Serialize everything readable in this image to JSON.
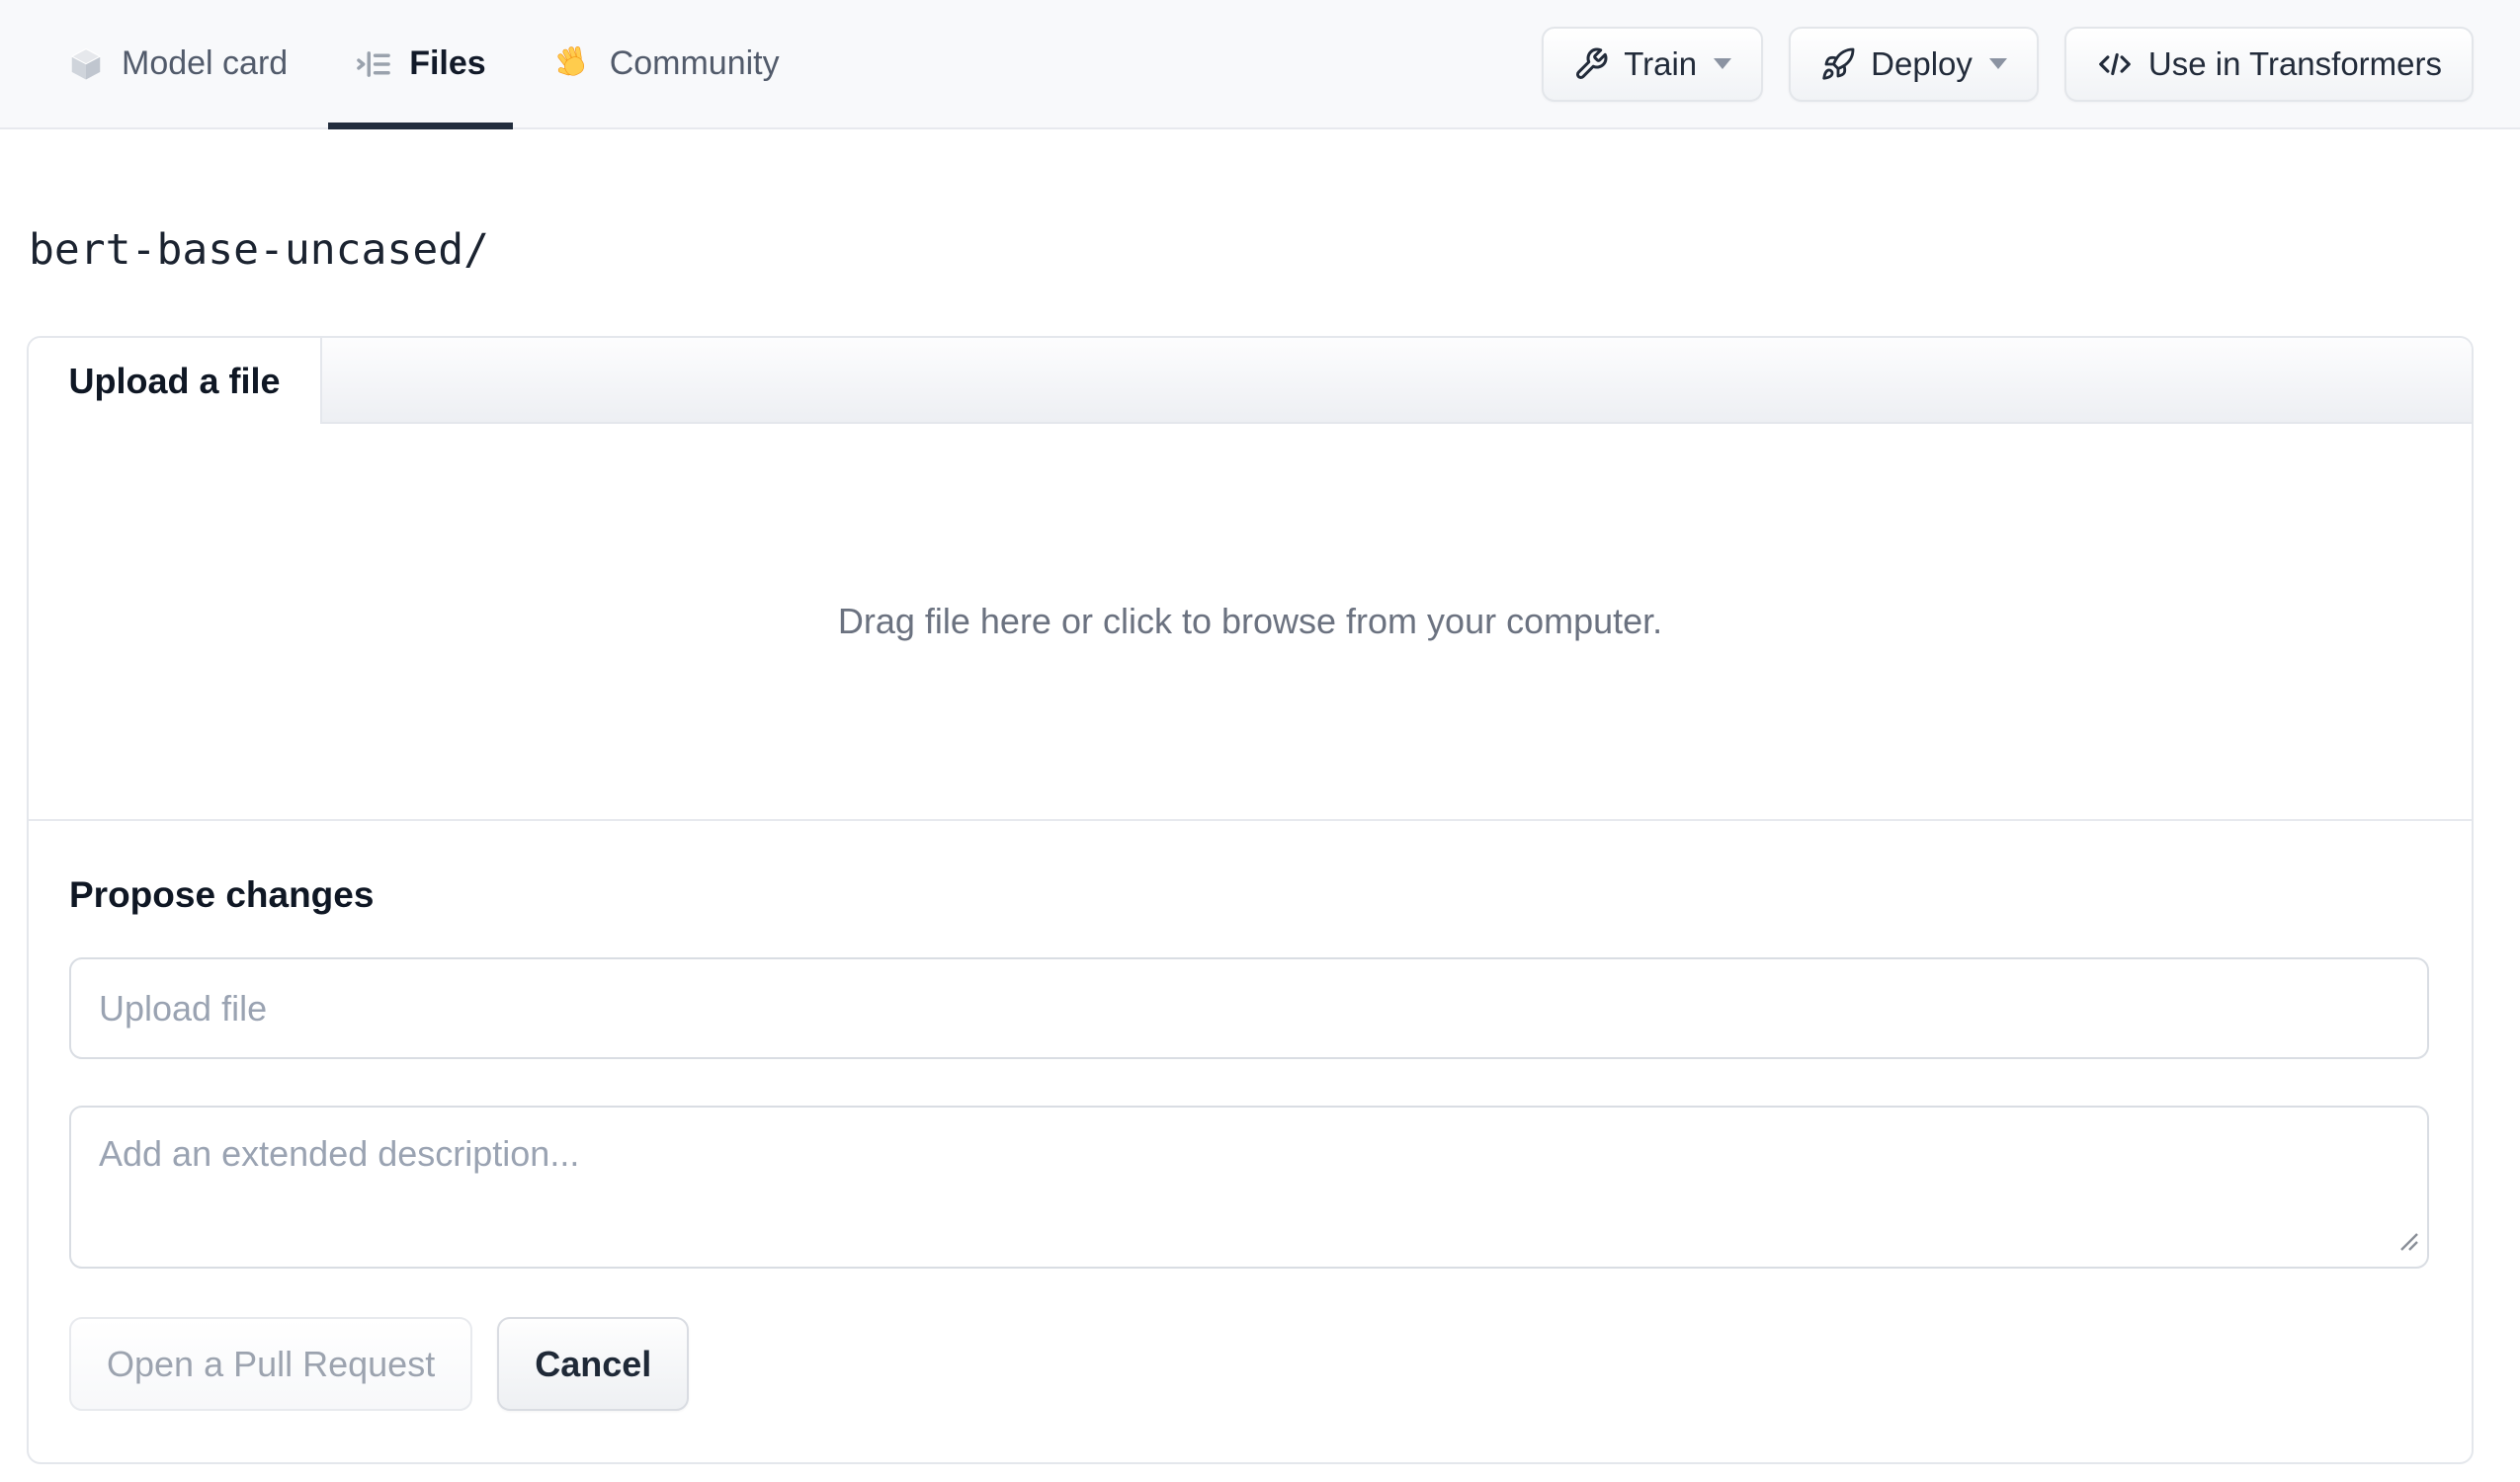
{
  "header": {
    "tabs": [
      {
        "label": "Model card",
        "icon": "cube-icon",
        "active": false
      },
      {
        "label": "Files",
        "icon": "files-list-icon",
        "active": true
      },
      {
        "label": "Community",
        "icon": "waving-hand-icon",
        "active": false
      }
    ],
    "actions": [
      {
        "label": "Train",
        "icon": "wrench-icon",
        "has_dropdown": true
      },
      {
        "label": "Deploy",
        "icon": "rocket-icon",
        "has_dropdown": true
      },
      {
        "label": "Use in Transformers",
        "icon": "code-icon",
        "has_dropdown": false
      }
    ]
  },
  "breadcrumb": {
    "path": "bert-base-uncased/"
  },
  "upload_panel": {
    "tab_label": "Upload a file",
    "dropzone_text": "Drag file here or click to browse from your computer."
  },
  "propose": {
    "title": "Propose changes",
    "file_input_placeholder": "Upload file",
    "description_placeholder": "Add an extended description...",
    "submit_label": "Open a Pull Request",
    "cancel_label": "Cancel"
  },
  "colors": {
    "header_background": "#f8f9fb",
    "active_tab_text": "#121a29",
    "active_tab_underline": "#222d3d",
    "inactive_tab_text": "#525b6b",
    "border": "#e4e7ec",
    "input_border": "#d9dde3",
    "muted_text": "#6b7280",
    "placeholder_text": "#9aa3b2",
    "disabled_button_text": "#9ca3af",
    "hand_yellow": "#FFCC4D"
  }
}
